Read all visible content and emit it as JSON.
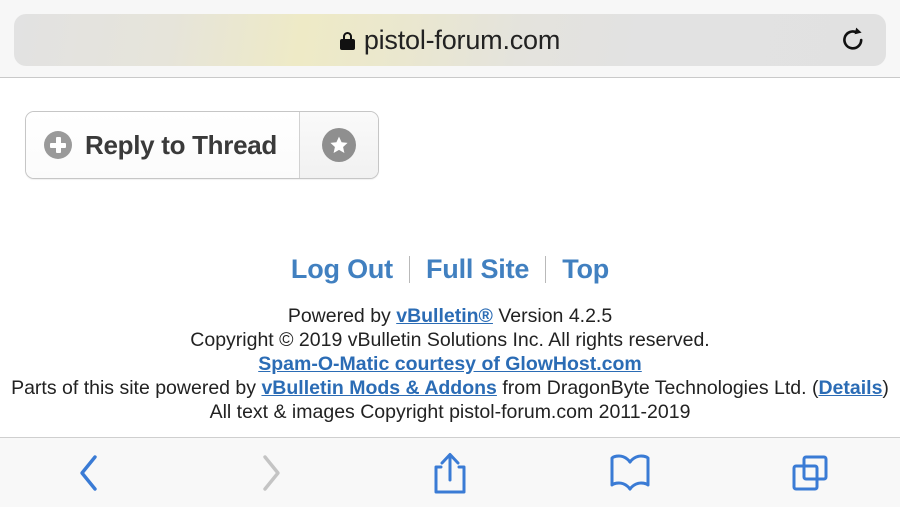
{
  "browser": {
    "url": "pistol-forum.com",
    "lock_icon": "lock-icon",
    "reload_icon": "reload-icon"
  },
  "page": {
    "reply_button": {
      "label": "Reply to Thread",
      "icon": "plus-circle-icon"
    },
    "favorite_button": {
      "icon": "star-circle-icon"
    },
    "nav_links": [
      {
        "label": "Log Out"
      },
      {
        "label": "Full Site"
      },
      {
        "label": "Top"
      }
    ],
    "footer": {
      "powered_prefix": "Powered by ",
      "vbulletin_link": "vBulletin®",
      "powered_suffix": " Version 4.2.5",
      "copyright": "Copyright © 2019 vBulletin Solutions Inc. All rights reserved.",
      "spam_link": "Spam-O-Matic courtesy of GlowHost.com",
      "parts_prefix": "Parts of this site powered by ",
      "mods_link": "vBulletin Mods & Addons",
      "parts_mid": " from DragonByte Technologies Ltd. (",
      "details_link": "Details",
      "parts_suffix": ")",
      "all_text": "All text & images Copyright pistol-forum.com 2011-2019"
    }
  },
  "toolbar": {
    "back_icon": "back-chevron-icon",
    "forward_icon": "forward-chevron-icon",
    "share_icon": "share-icon",
    "bookmarks_icon": "bookmarks-icon",
    "tabs_icon": "tabs-icon"
  },
  "colors": {
    "link_blue": "#4180c0",
    "footer_link_blue": "#2b6cb5",
    "toolbar_blue": "#3a7bd5",
    "chrome_bg": "#f7f7f7",
    "urlbar_bg": "#e2e2e2"
  }
}
